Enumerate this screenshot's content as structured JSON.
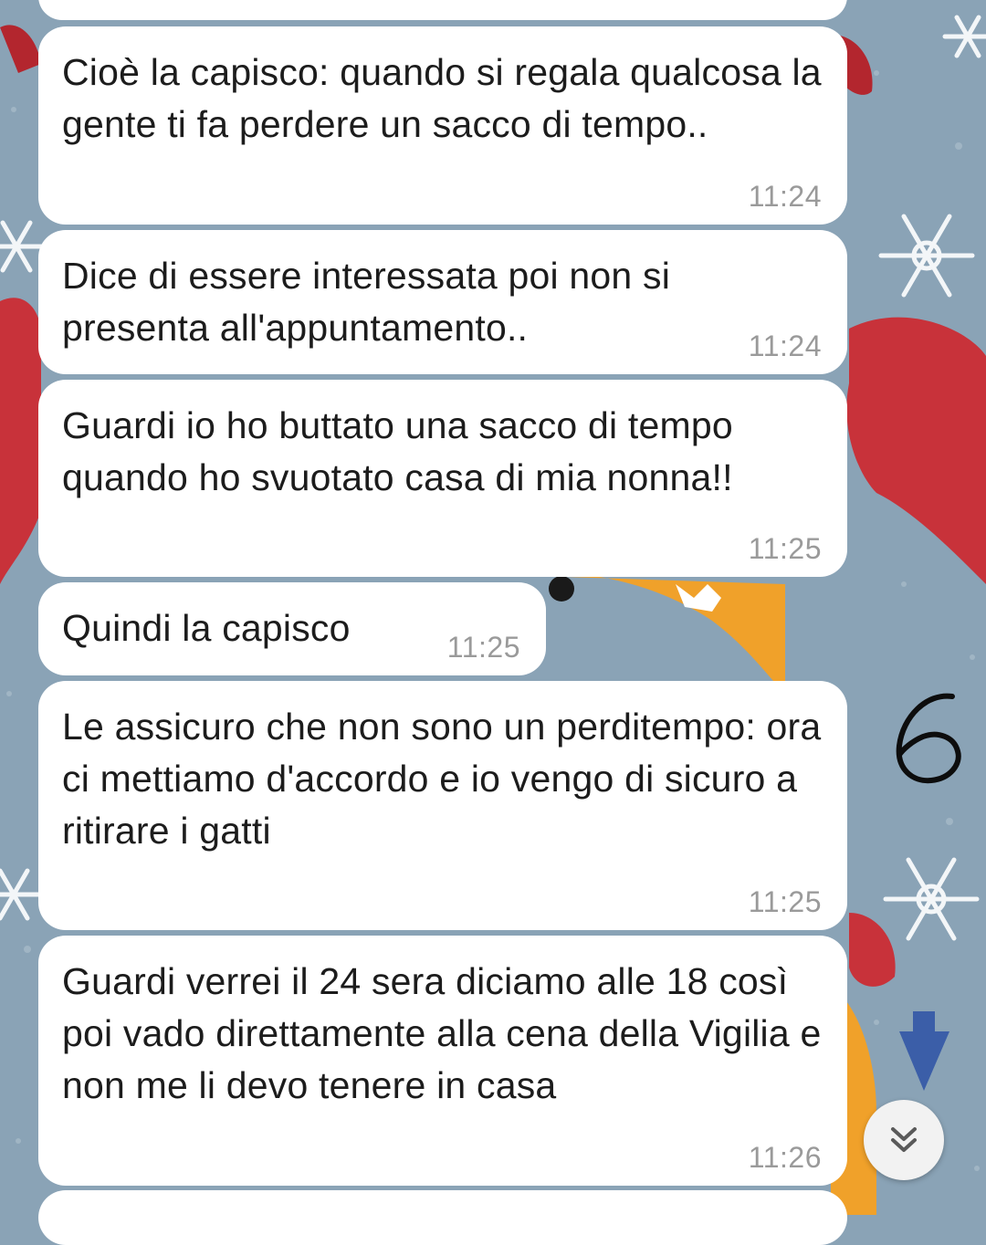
{
  "chat": {
    "messages": [
      {
        "text": "",
        "time": ""
      },
      {
        "text": "Cioè la capisco: quando si regala qualcosa la gente ti fa perdere un sacco di tempo..",
        "time": "11:24"
      },
      {
        "text": "Dice di essere interessata poi non si presenta all'appuntamento..",
        "time": "11:24"
      },
      {
        "text": "Guardi io ho buttato una sacco di tempo quando ho svuotato casa di mia nonna!!",
        "time": "11:25"
      },
      {
        "text": "Quindi la capisco",
        "time": "11:25"
      },
      {
        "text": "Le assicuro che non sono un perditempo: ora ci mettiamo d'accordo e io vengo di sicuro a ritirare i gatti",
        "time": "11:25"
      },
      {
        "text": "Guardi verrei il 24 sera diciamo alle 18 così poi vado direttamente alla cena della Vigilia e non me li devo tenere in casa",
        "time": "11:26"
      },
      {
        "text": "",
        "time": ""
      }
    ]
  },
  "annotation": {
    "handwritten_mark": "6"
  },
  "controls": {
    "scroll_down_icon": "double-chevron-down-icon"
  },
  "colors": {
    "wallpaper_blue": "#8aa3b6",
    "wallpaper_red": "#c8323a",
    "wallpaper_orange": "#f0a12a",
    "bubble": "#ffffff",
    "timestamp": "#9a9a9a"
  }
}
